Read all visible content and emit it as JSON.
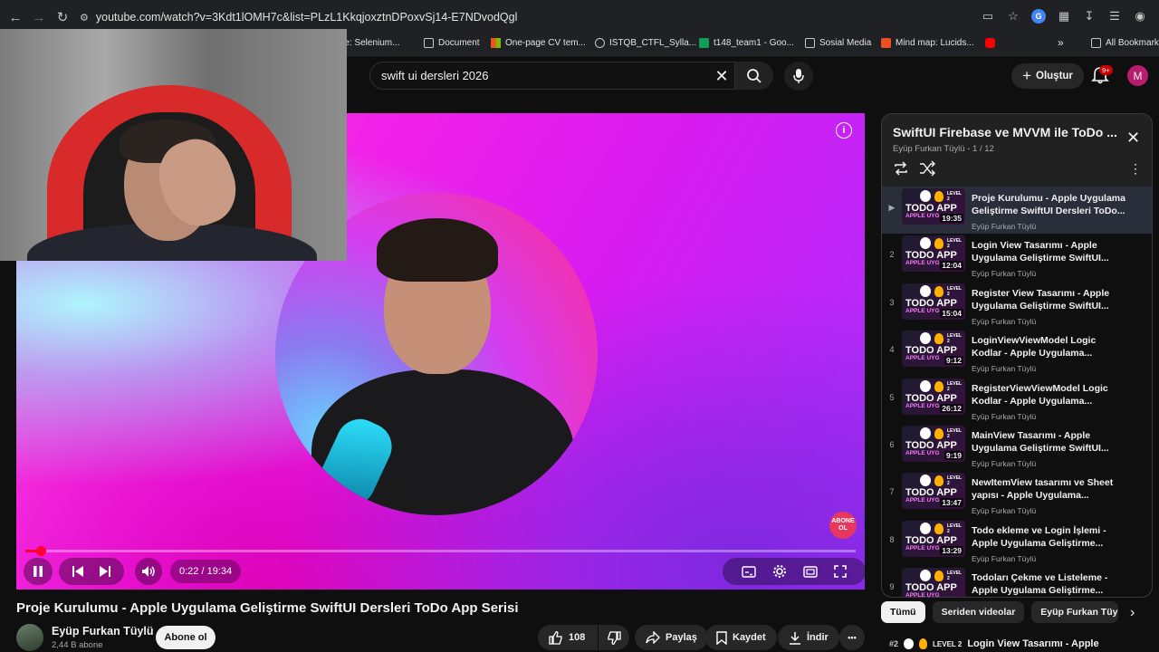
{
  "browser": {
    "url": "youtube.com/watch?v=3Kdt1lOMH7c&list=PLzL1KkqjoxztnDPoxvSj14-E7NDvodQgl",
    "bookmarks": [
      "rse: Selenium...",
      "Document",
      "One-page CV tem...",
      "ISTQB_CTFL_Sylla...",
      "t148_team1 - Goo...",
      "Sosial Media",
      "Mind map: Lucids..."
    ],
    "all_bookmarks": "All Bookmarks",
    "more_bookmarks": "»"
  },
  "topbar": {
    "search_value": "swift ui dersleri 2026",
    "create_label": "Oluştur",
    "notifications_badge": "9+",
    "avatar_letter": "M"
  },
  "player": {
    "time": "0:22 / 19:34",
    "progress_fraction": 0.019,
    "subscribe_badge": "ABONE OL"
  },
  "video": {
    "title": "Proje Kurulumu - Apple Uygulama Geliştirme SwiftUI Dersleri ToDo App Serisi",
    "channel": "Eyüp Furkan Tüylü",
    "subscribers": "2,44 B abone",
    "subscribe_label": "Abone ol",
    "likes": "108",
    "share_label": "Paylaş",
    "save_label": "Kaydet",
    "download_label": "İndir",
    "more_label": "•••"
  },
  "playlist": {
    "title": "SwiftUI Firebase ve MVVM ile ToDo ...",
    "owner": "Eyüp Furkan Tüylü",
    "position": "1 / 12",
    "thumb_text": {
      "top": "TODO APP",
      "bottom": "APPLE UYG",
      "level": "LEVEL 2"
    },
    "items": [
      {
        "index": "▶",
        "title": "Proje Kurulumu - Apple Uygulama Geliştirme SwiftUI Dersleri ToDo...",
        "channel": "Eyüp Furkan Tüylü",
        "duration": "19:35"
      },
      {
        "index": "2",
        "title": "Login View Tasarımı - Apple Uygulama Geliştirme SwiftUI...",
        "channel": "Eyüp Furkan Tüylü",
        "duration": "12:04"
      },
      {
        "index": "3",
        "title": "Register View Tasarımı - Apple Uygulama Geliştirme SwiftUI...",
        "channel": "Eyüp Furkan Tüylü",
        "duration": "15:04"
      },
      {
        "index": "4",
        "title": "LoginViewViewModel Logic Kodlar - Apple Uygulama...",
        "channel": "Eyüp Furkan Tüylü",
        "duration": "9:12"
      },
      {
        "index": "5",
        "title": "RegisterViewViewModel Logic Kodlar - Apple Uygulama...",
        "channel": "Eyüp Furkan Tüylü",
        "duration": "26:12"
      },
      {
        "index": "6",
        "title": "MainView Tasarımı - Apple Uygulama Geliştirme SwiftUI...",
        "channel": "Eyüp Furkan Tüylü",
        "duration": "9:19"
      },
      {
        "index": "7",
        "title": "NewItemView tasarımı ve Sheet yapısı - Apple Uygulama...",
        "channel": "Eyüp Furkan Tüylü",
        "duration": "13:47"
      },
      {
        "index": "8",
        "title": "Todo ekleme ve Login İşlemi - Apple Uygulama Geliştirme...",
        "channel": "Eyüp Furkan Tüylü",
        "duration": "13:29"
      },
      {
        "index": "9",
        "title": "Todoları Çekme ve Listeleme - Apple Uygulama Geliştirme...",
        "channel": "Eyüp Furkan Tüylü",
        "duration": ""
      }
    ]
  },
  "chips": [
    "Tümü",
    "Seriden videolar",
    "Eyüp Furkan Tüylü ad"
  ],
  "next_item": {
    "badge": "#2",
    "level": "LEVEL 2",
    "title": "Login View Tasarımı - Apple"
  },
  "colors": {
    "accent_red": "#ff0033",
    "background": "#0f0f0f",
    "chip_selected": "#f1f1f1"
  }
}
